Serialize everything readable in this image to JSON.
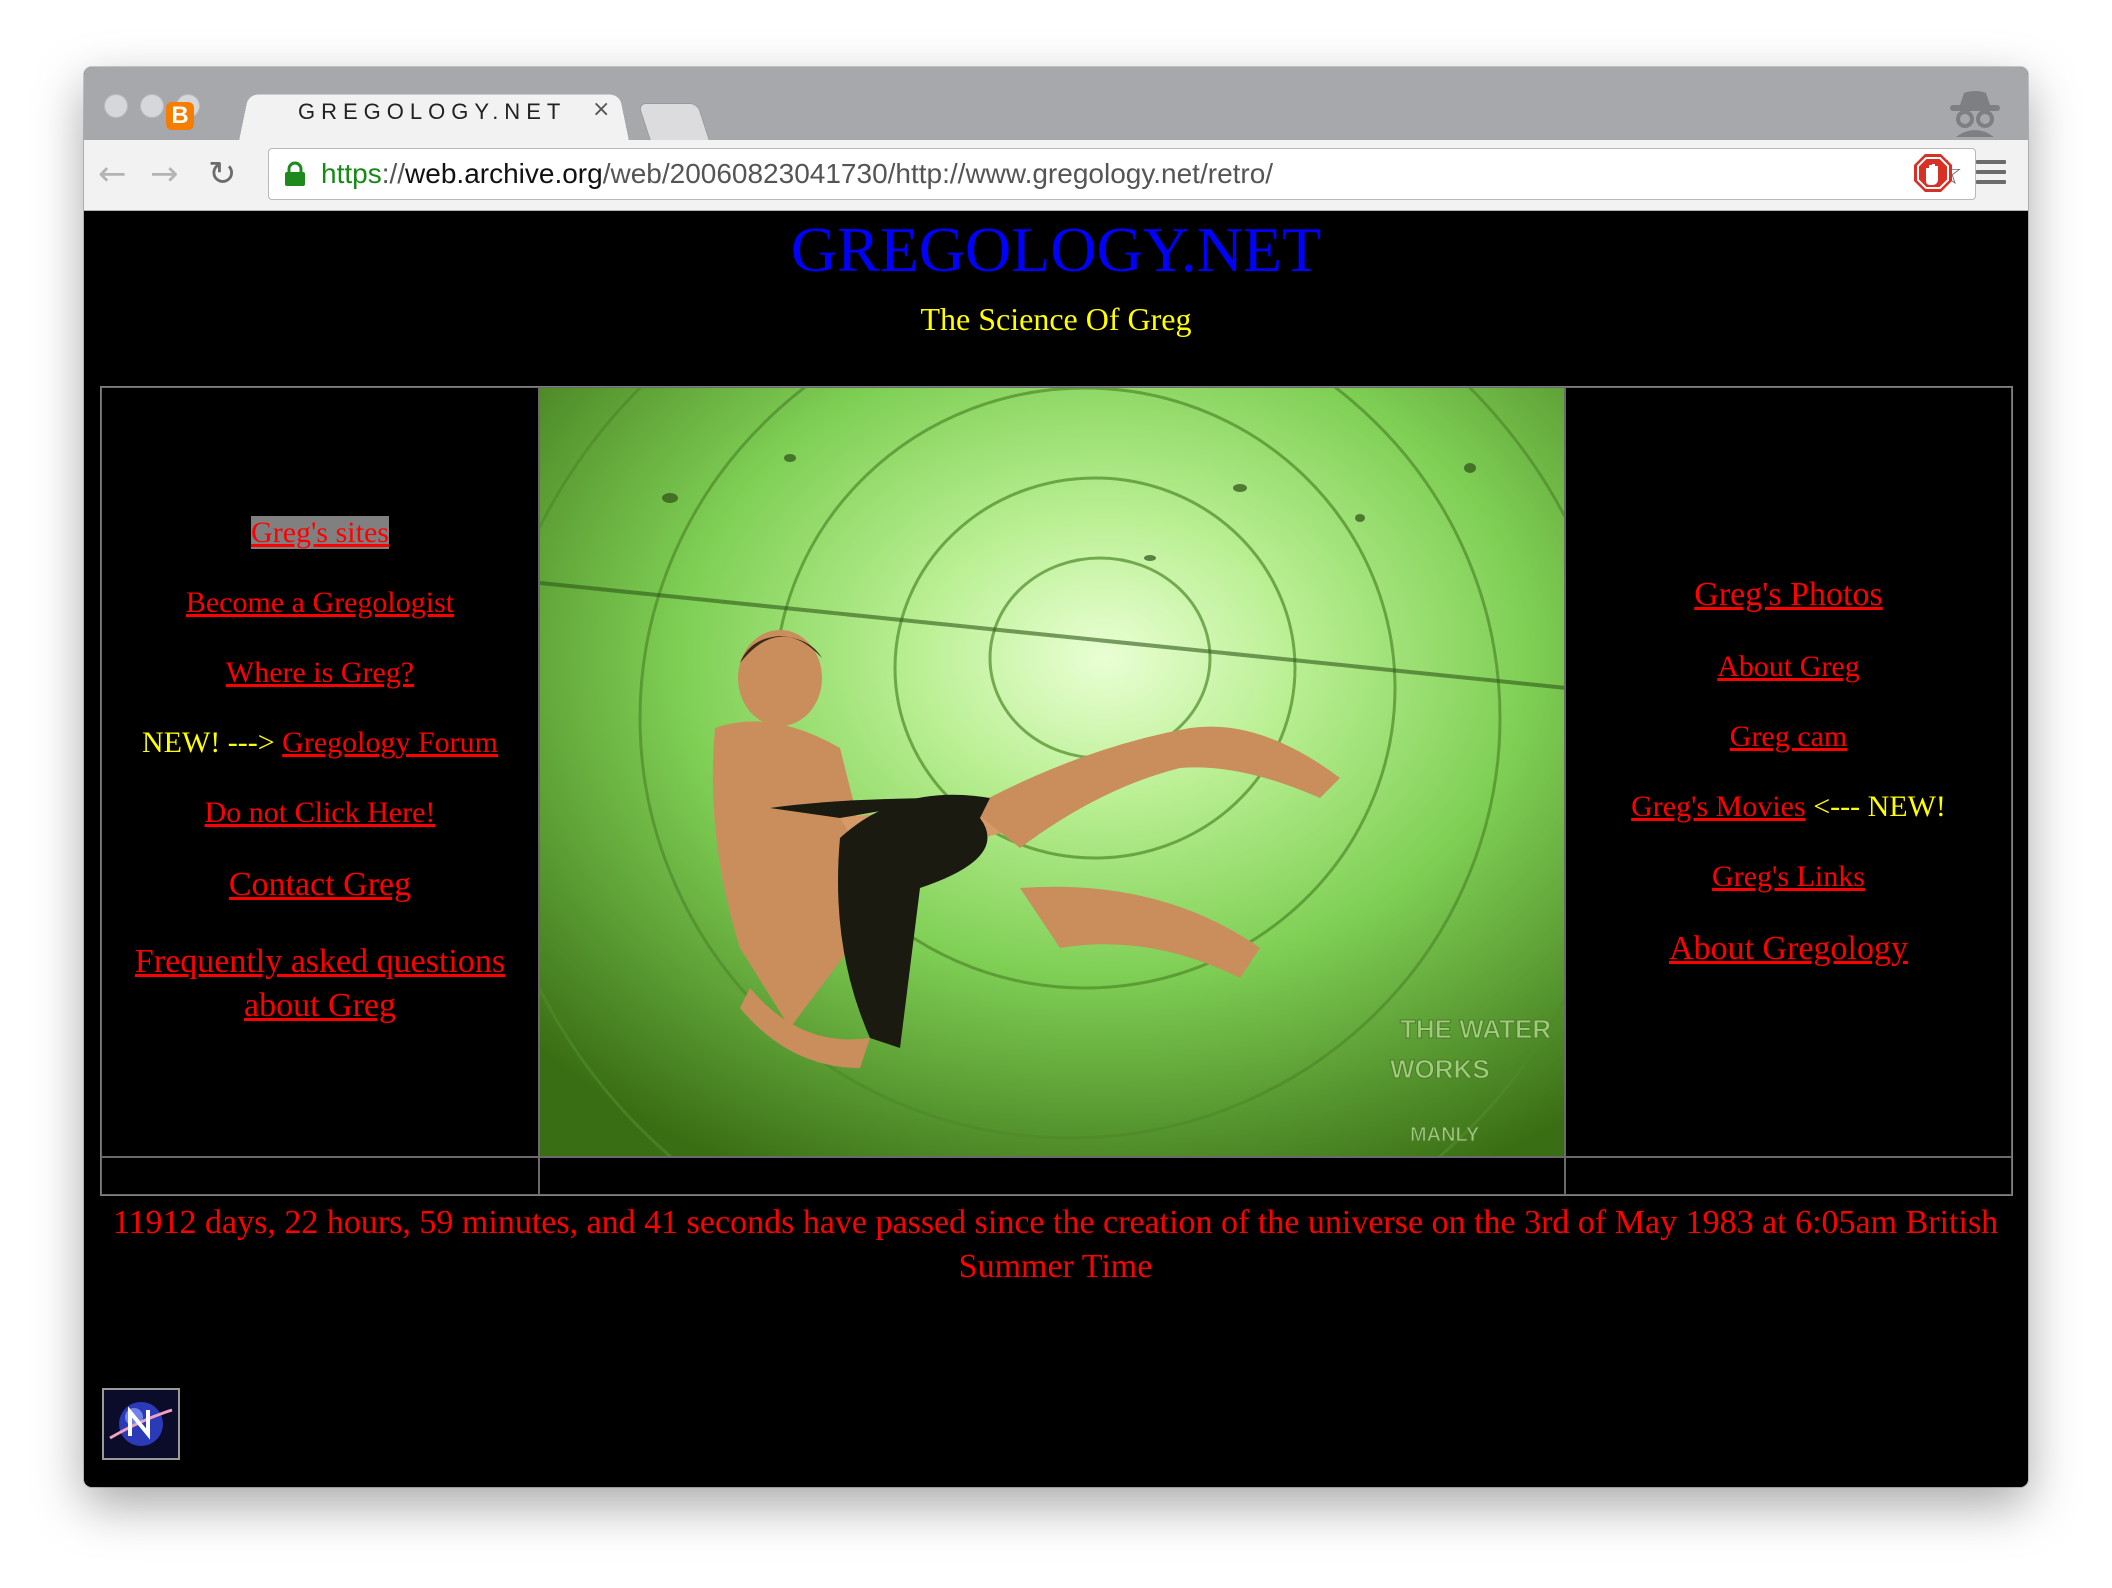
{
  "browser": {
    "tab_title": "GREGOLOGY.NET",
    "tab_close": "×",
    "favicon_letter": "B",
    "url_scheme": "https",
    "url_sep": "://",
    "url_host": "web.archive.org",
    "url_path": "/web/20060823041730/http://www.gregology.net/retro/",
    "back": "←",
    "forward": "→",
    "reload": "↻",
    "star": "☆"
  },
  "page": {
    "title": "GREGOLOGY.NET",
    "tagline": "The Science Of Greg",
    "left_nav": {
      "sites": "Greg's sites",
      "become": "Become a Gregologist",
      "where": "Where is Greg?",
      "new_prefix": "NEW! --->",
      "forum": "Gregology Forum",
      "donot": "Do not Click Here!",
      "contact": "Contact Greg",
      "faq": "Frequently asked questions about Greg"
    },
    "right_nav": {
      "photos": "Greg's Photos",
      "about": "About Greg",
      "cam": "Greg cam",
      "movies": "Greg's Movies",
      "new_suffix": "<--- NEW!",
      "links": "Greg's Links",
      "about_gregology": "About Gregology"
    },
    "photo_watermark_1": "THE WATER",
    "photo_watermark_2": "WORKS",
    "photo_watermark_3": "MANLY",
    "counter": "11912 days, 22 hours, 59 minutes, and 41 seconds have passed since the creation of the universe on the 3rd of May 1983 at 6:05am British Summer Time"
  },
  "colors": {
    "title": "#0000ff",
    "link": "#ff0000",
    "highlight": "#ffff00",
    "background": "#000000"
  }
}
